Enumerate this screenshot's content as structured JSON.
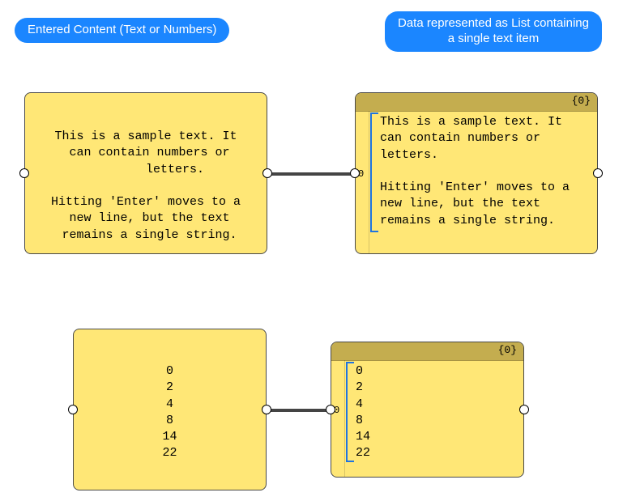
{
  "labels": {
    "left": "Entered Content (Text or Numbers)",
    "right": "Data represented as List containing\na single text item"
  },
  "panels": {
    "topLeft": {
      "text": "This is a sample text. It\n can contain numbers or\n        letters.\n\nHitting 'Enter' moves to a\n new line, but the text\n remains a single string."
    },
    "topRight": {
      "path": "{0}",
      "index": "0",
      "text": "This is a sample text. It\ncan contain numbers or\nletters.\n\nHitting 'Enter' moves to a\nnew line, but the text\nremains a single string."
    },
    "bottomLeft": {
      "text": "0\n2\n4\n8\n14\n22"
    },
    "bottomRight": {
      "path": "{0}",
      "index": "0",
      "text": "0\n2\n4\n8\n14\n22"
    }
  }
}
